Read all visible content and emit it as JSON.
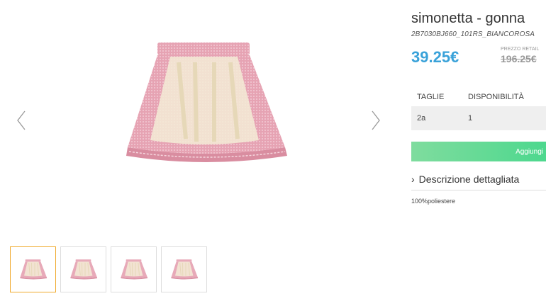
{
  "product": {
    "title": "simonetta - gonna",
    "sku": "2B7030BJ660_101RS_BIANCOROSA",
    "price": "39.25€",
    "retail_label": "PREZZO RETAIL",
    "retail_price": "196.25€"
  },
  "availability": {
    "headers": [
      "TAGLIE",
      "DISPONIBILITÀ"
    ],
    "rows": [
      [
        "2a",
        "1"
      ]
    ]
  },
  "actions": {
    "add_label": "Aggiungi"
  },
  "description": {
    "toggle_label": "Descrizione dettagliata",
    "text": "100%poliestere"
  },
  "gallery": {
    "thumbnail_count": 4,
    "active_thumbnail": 1
  },
  "colors": {
    "price": "#3aa2d9",
    "button_start": "#7fdc9e",
    "button_end": "#4dd88e",
    "thumb_active_border": "#f0a92b",
    "skirt_pink": "#e8a9b8",
    "skirt_cream": "#f3ecd6"
  }
}
